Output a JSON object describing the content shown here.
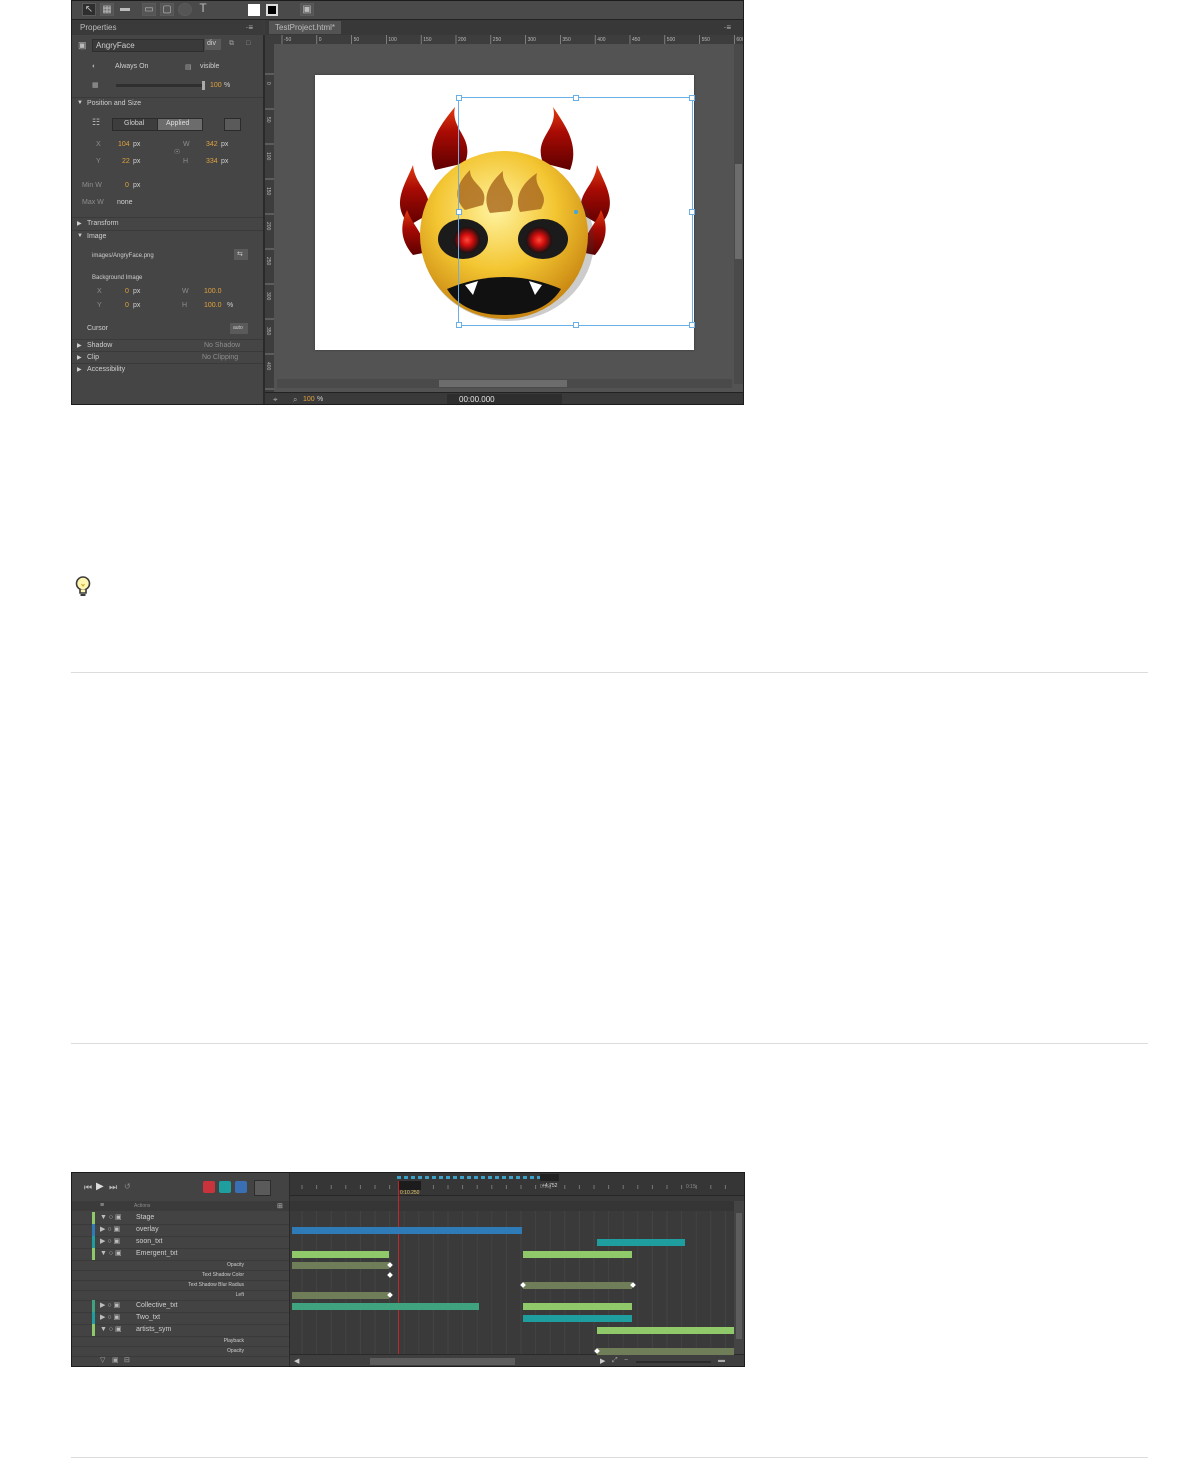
{
  "screenshot1": {
    "toolbar": {
      "tools": [
        "selection-tool",
        "transform-tool",
        "clipping-tool",
        "rectangle-tool",
        "rounded-rectangle-tool",
        "ellipse-tool",
        "text-tool"
      ],
      "text_tool_glyph": "T"
    },
    "properties_panel": {
      "tab_label": "Properties",
      "menu_glyph": "·≡",
      "element_name": "AngryFace",
      "element_tag": "div",
      "display_value": "Always On",
      "overflow_value": "visible",
      "opacity_value": "100",
      "opacity_unit": "%",
      "section_position": "Position and Size",
      "global_button": "Global",
      "applied_button": "Applied",
      "x_label": "X",
      "x_value": "104",
      "y_label": "Y",
      "y_value": "22",
      "w_label": "W",
      "w_value": "342",
      "h_label": "H",
      "h_value": "334",
      "px_unit": "px",
      "min_w_label": "Min W",
      "min_w_value": "0",
      "max_w_label": "Max W",
      "max_w_value": "none",
      "section_transform": "Transform",
      "section_image": "Image",
      "image_path": "images/AngryFace.png",
      "background_image_label": "Background Image",
      "bg_x_label": "X",
      "bg_x_value": "0",
      "bg_y_label": "Y",
      "bg_y_value": "0",
      "bg_w_label": "W",
      "bg_w_value": "100.0",
      "bg_h_label": "H",
      "bg_h_value": "100.0",
      "bg_unit": "%",
      "cursor_label": "Cursor",
      "cursor_value": "auto",
      "shadow_label": "Shadow",
      "shadow_value": "No Shadow",
      "clip_label": "Clip",
      "clip_value": "No Clipping",
      "accessibility_label": "Accessibility"
    },
    "stage_panel": {
      "tab_label": "TestProject.html*",
      "menu_glyph": "·≡",
      "ruler_ticks": [
        "-50",
        "0",
        "50",
        "100",
        "150",
        "200",
        "250",
        "300",
        "350",
        "400",
        "450",
        "500",
        "550",
        "600"
      ],
      "vruler_ticks": [
        "0",
        "50",
        "100",
        "150",
        "200",
        "250",
        "300",
        "350",
        "400",
        "450"
      ],
      "zoom_value": "100",
      "zoom_unit": "%",
      "timecode": "00:00.000"
    }
  },
  "screenshot2": {
    "actions_label": "Actions",
    "playhead_time": "0:10.250",
    "duration_label": "+4.752",
    "ruler_marks": [
      "0:10",
      "0:15"
    ],
    "colors": {
      "blue": "#2f7bb7",
      "teal": "#1f9ea0",
      "green": "#8fc96a",
      "olive": "#6f7d58",
      "seagreen": "#3ea37e",
      "playhead": "#c0262a"
    },
    "rows": [
      {
        "name": "Stage"
      },
      {
        "name": "overlay"
      },
      {
        "name": "soon_txt"
      },
      {
        "name": "Emergent_txt"
      },
      {
        "name": "Collective_txt"
      },
      {
        "name": "Two_txt"
      },
      {
        "name": "artists_sym"
      }
    ],
    "sub_props": [
      {
        "name": "Opacity"
      },
      {
        "name": "Text Shadow Color"
      },
      {
        "name": "Text Shadow Blur Radius"
      },
      {
        "name": "Left"
      },
      {
        "name": "Playback"
      },
      {
        "name": "Opacity"
      }
    ]
  }
}
